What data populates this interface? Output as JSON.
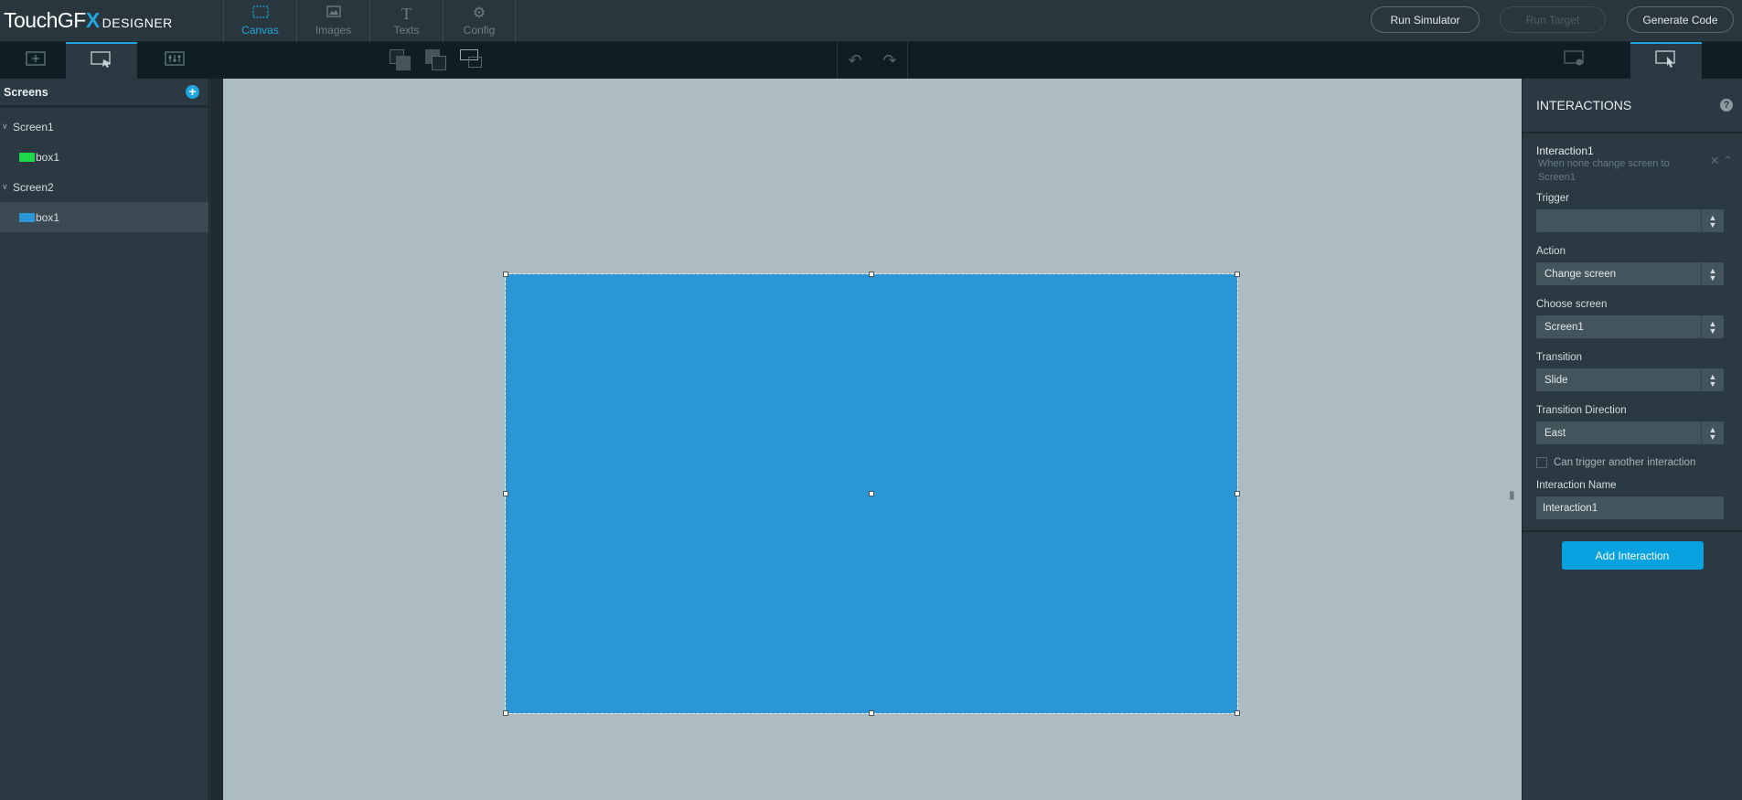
{
  "app": {
    "logo_main": "TouchGF",
    "logo_x": "X",
    "logo_sub": "DESIGNER"
  },
  "nav": {
    "tabs": [
      {
        "label": "Canvas",
        "icon": "canvas-icon",
        "active": true
      },
      {
        "label": "Images",
        "icon": "images-icon",
        "active": false
      },
      {
        "label": "Texts",
        "icon": "texts-icon",
        "active": false
      },
      {
        "label": "Config",
        "icon": "config-icon",
        "active": false
      }
    ]
  },
  "top_buttons": {
    "run_simulator": "Run Simulator",
    "run_target": "Run Target",
    "generate_code": "Generate Code"
  },
  "left_panel": {
    "title": "Screens",
    "screens": [
      {
        "name": "Screen1",
        "children": [
          {
            "name": "box1",
            "color": "#1fd84a"
          }
        ]
      },
      {
        "name": "Screen2",
        "children": [
          {
            "name": "box1",
            "color": "#2a96d6"
          }
        ]
      }
    ]
  },
  "canvas": {
    "box_color": "#2a96d6",
    "background": "#adbcc2"
  },
  "right_panel": {
    "title": "INTERACTIONS",
    "interaction": {
      "name": "Interaction1",
      "description": "When none change screen to Screen1",
      "trigger_label": "Trigger",
      "trigger_value": "",
      "action_label": "Action",
      "action_value": "Change screen",
      "choose_screen_label": "Choose screen",
      "choose_screen_value": "Screen1",
      "transition_label": "Transition",
      "transition_value": "Slide",
      "direction_label": "Transition Direction",
      "direction_value": "East",
      "can_trigger_label": "Can trigger another interaction",
      "can_trigger_checked": false,
      "name_label": "Interaction Name",
      "name_value": "Interaction1"
    },
    "add_button": "Add Interaction"
  },
  "colors": {
    "accent": "#1fa6e0",
    "panel": "#2b3a42",
    "toolbar": "#0f1e25"
  }
}
